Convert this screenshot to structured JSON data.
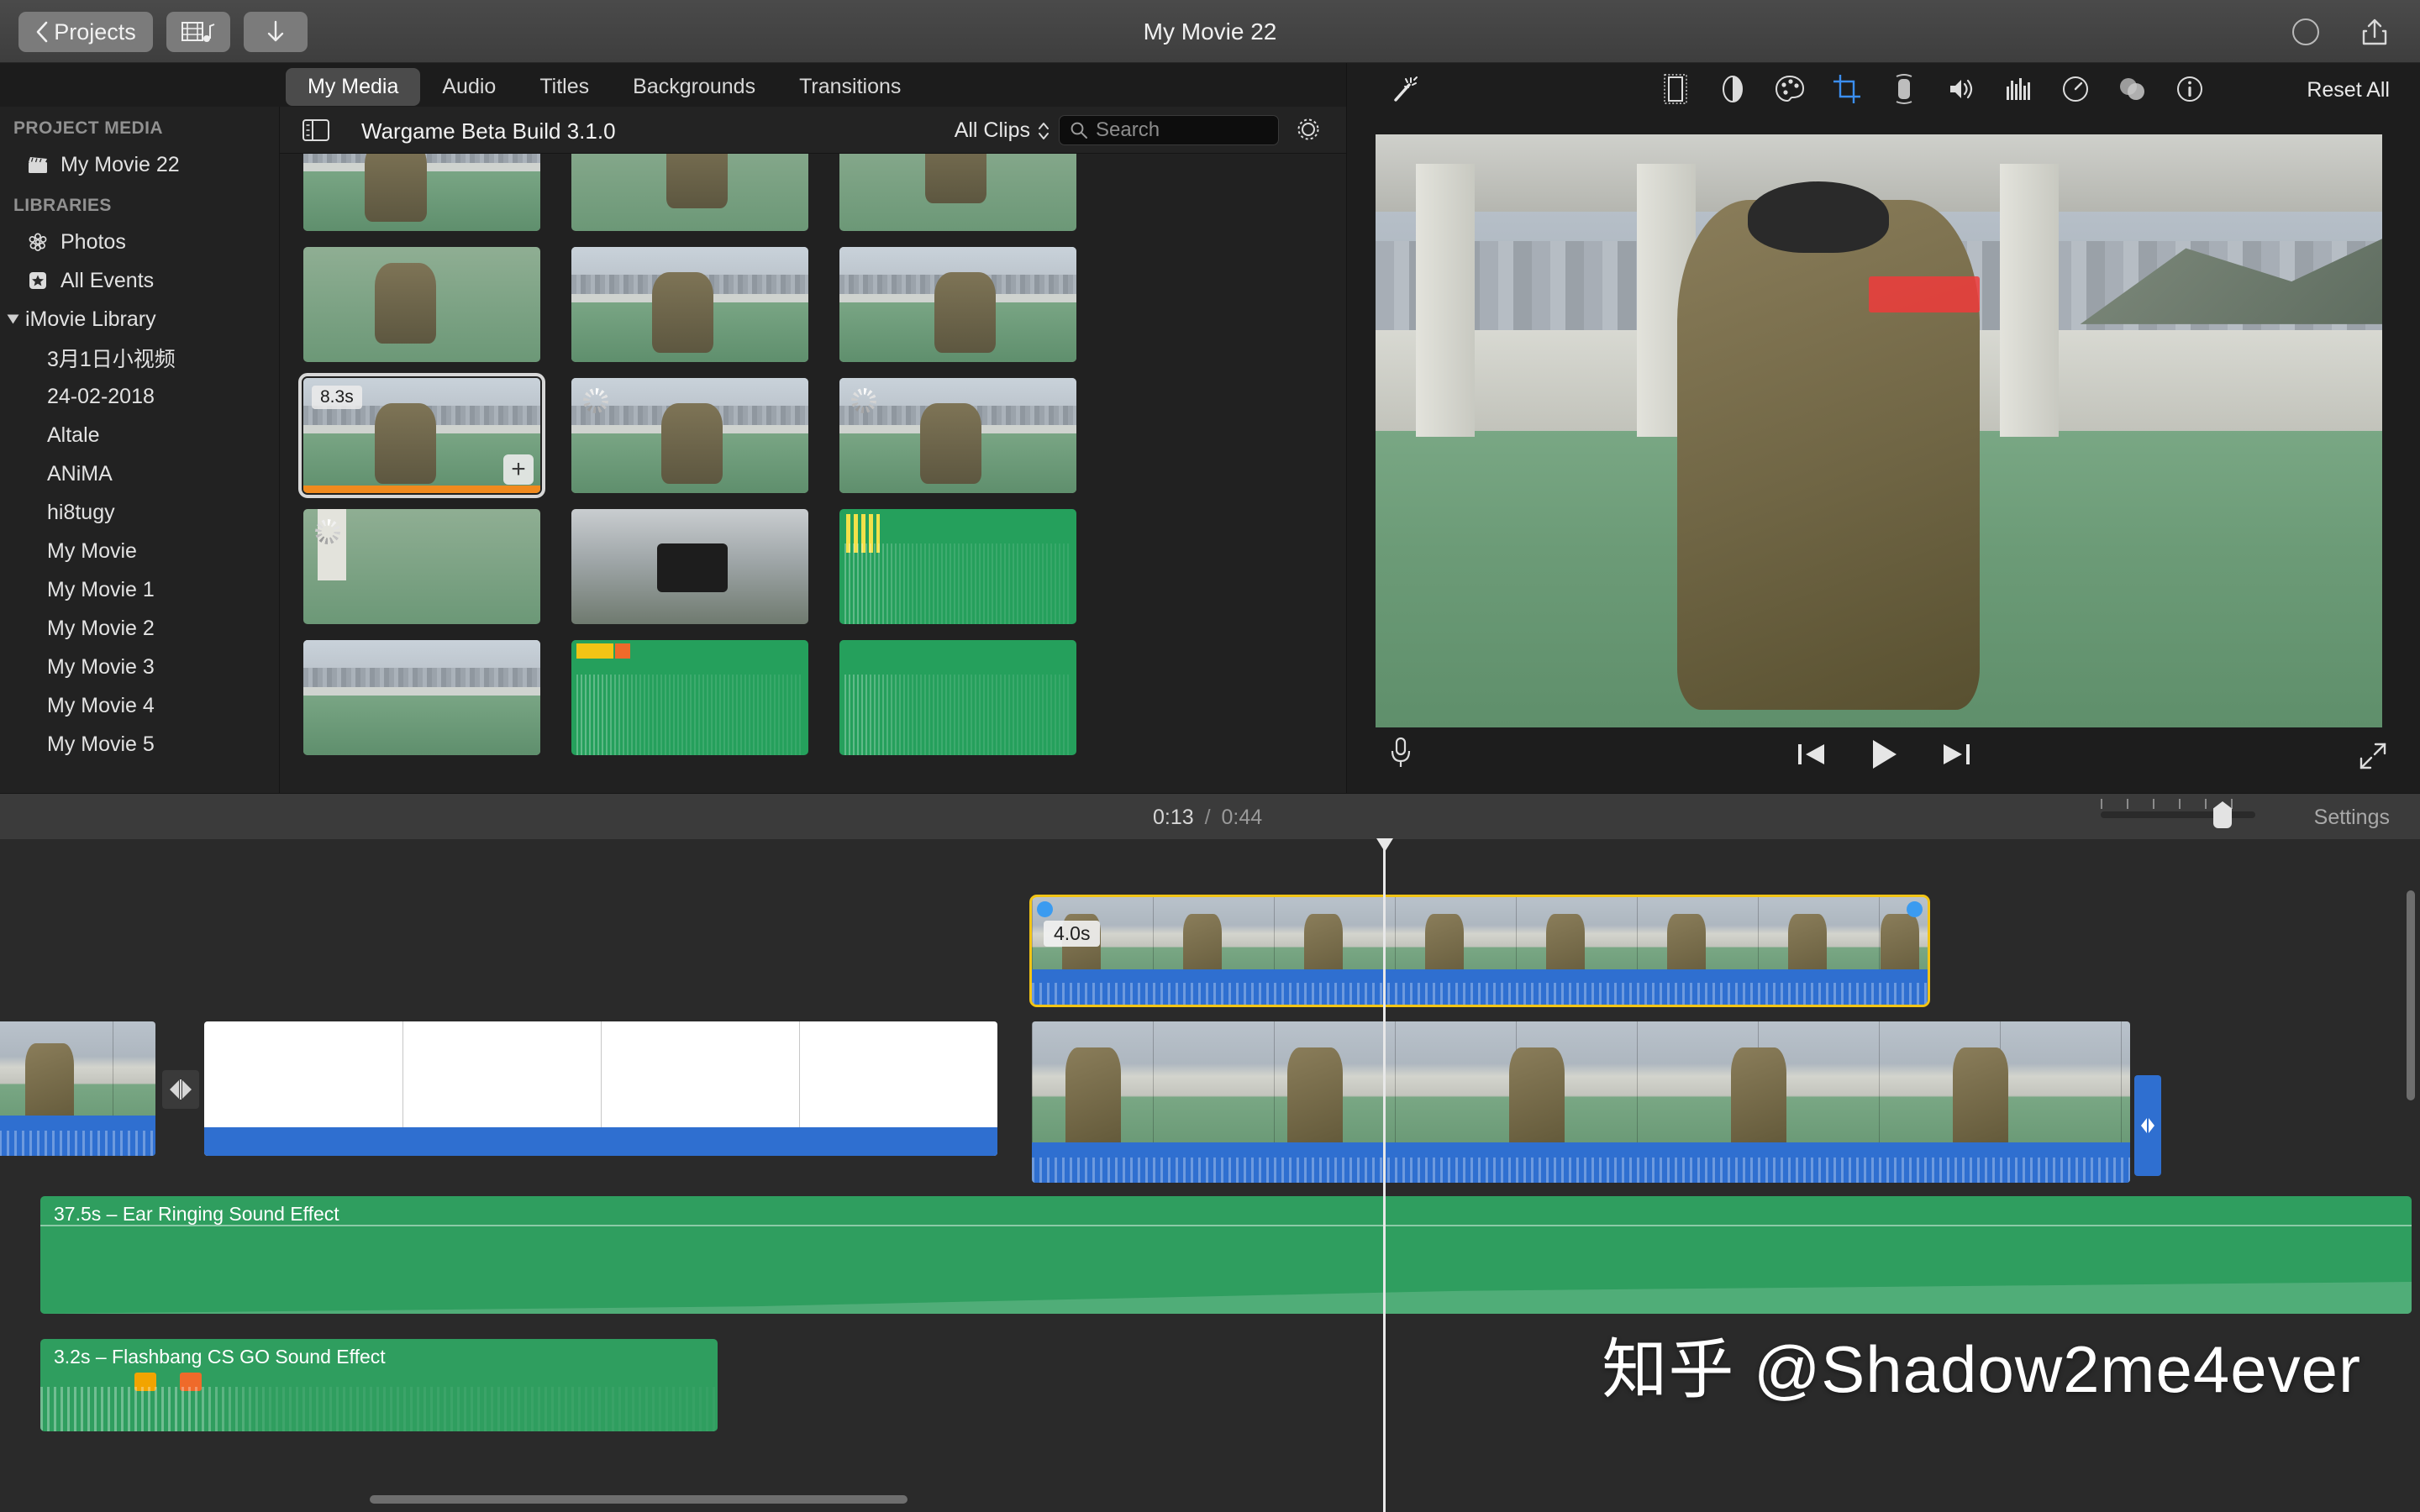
{
  "titlebar": {
    "back_label": "Projects",
    "import_icon": "film-music-icon",
    "download_icon": "download-arrow-icon",
    "project_title": "My Movie 22",
    "record_icon": "record-circle-icon",
    "share_icon": "share-icon"
  },
  "tabs": [
    {
      "label": "My Media",
      "active": true
    },
    {
      "label": "Audio",
      "active": false
    },
    {
      "label": "Titles",
      "active": false
    },
    {
      "label": "Backgrounds",
      "active": false
    },
    {
      "label": "Transitions",
      "active": false
    }
  ],
  "sidebar": {
    "project_media_header": "PROJECT MEDIA",
    "project_media_items": [
      {
        "label": "My Movie 22",
        "icon": "clapperboard-icon"
      }
    ],
    "libraries_header": "LIBRARIES",
    "library_items": [
      {
        "label": "Photos",
        "icon": "photos-flower-icon"
      },
      {
        "label": "All Events",
        "icon": "star-icon"
      }
    ],
    "imovie_library_label": "iMovie Library",
    "events": [
      "3月1日小视频",
      "24-02-2018",
      "Altale",
      "ANiMA",
      "hi8tugy",
      "My Movie",
      "My Movie 1",
      "My Movie 2",
      "My Movie 3",
      "My Movie 4",
      "My Movie 5"
    ]
  },
  "browser_toolbar": {
    "sidebar_toggle_icon": "sidebar-toggle-icon",
    "event_title": "Wargame Beta Build 3.1.0",
    "filter_label": "All Clips",
    "filter_icon": "chevron-updown-icon",
    "search_placeholder": "Search",
    "search_value": "",
    "search_icon": "search-icon",
    "settings_icon": "gear-icon"
  },
  "browser_clips": [
    {
      "row": 0,
      "col": 0,
      "kind": "video",
      "badge": "",
      "selected": false,
      "loading": false,
      "style": "rooftop-dark"
    },
    {
      "row": 0,
      "col": 1,
      "kind": "video",
      "badge": "",
      "selected": false,
      "loading": false,
      "style": "rooftop-green"
    },
    {
      "row": 0,
      "col": 2,
      "kind": "video",
      "badge": "",
      "selected": false,
      "loading": false,
      "style": "rooftop-green"
    },
    {
      "row": 1,
      "col": 0,
      "kind": "video",
      "badge": "",
      "selected": false,
      "loading": false,
      "style": "rooftop-green"
    },
    {
      "row": 1,
      "col": 1,
      "kind": "video",
      "badge": "",
      "selected": false,
      "loading": false,
      "style": "rooftop-city"
    },
    {
      "row": 1,
      "col": 2,
      "kind": "video",
      "badge": "",
      "selected": false,
      "loading": false,
      "style": "rooftop-city"
    },
    {
      "row": 2,
      "col": 0,
      "kind": "video",
      "badge": "8.3s",
      "selected": true,
      "loading": false,
      "style": "rooftop-city",
      "has_add": true,
      "range_selected": true
    },
    {
      "row": 2,
      "col": 1,
      "kind": "video",
      "badge": "",
      "selected": false,
      "loading": true,
      "style": "rooftop-city"
    },
    {
      "row": 2,
      "col": 2,
      "kind": "video",
      "badge": "",
      "selected": false,
      "loading": true,
      "style": "rooftop-city"
    },
    {
      "row": 3,
      "col": 0,
      "kind": "video",
      "badge": "",
      "selected": false,
      "loading": true,
      "style": "rooftop-floor"
    },
    {
      "row": 3,
      "col": 1,
      "kind": "video",
      "badge": "",
      "selected": false,
      "loading": false,
      "style": "indoor-scope"
    },
    {
      "row": 3,
      "col": 2,
      "kind": "audio",
      "badge": "",
      "selected": false,
      "loading": false,
      "style": "audio-green"
    },
    {
      "row": 4,
      "col": 0,
      "kind": "video",
      "badge": "",
      "selected": false,
      "loading": false,
      "style": "rooftop-city"
    },
    {
      "row": 4,
      "col": 1,
      "kind": "audio",
      "badge": "",
      "selected": false,
      "loading": false,
      "style": "audio-green"
    },
    {
      "row": 4,
      "col": 2,
      "kind": "audio",
      "badge": "",
      "selected": false,
      "loading": false,
      "style": "audio-green"
    }
  ],
  "viewer": {
    "magic_icon": "magic-wand-icon",
    "reset_label": "Reset All",
    "adjust_icons": [
      {
        "name": "crop-frame-icon",
        "selected": false
      },
      {
        "name": "color-balance-icon",
        "selected": false
      },
      {
        "name": "color-correction-icon",
        "selected": false
      },
      {
        "name": "crop-icon",
        "selected": true
      },
      {
        "name": "stabilization-icon",
        "selected": false
      },
      {
        "name": "volume-icon",
        "selected": false
      },
      {
        "name": "equalizer-icon",
        "selected": false
      },
      {
        "name": "speed-icon",
        "selected": false
      },
      {
        "name": "filter-icon",
        "selected": false
      },
      {
        "name": "info-icon",
        "selected": false
      }
    ],
    "controls": {
      "mic_icon": "microphone-icon",
      "prev_icon": "skip-previous-icon",
      "play_icon": "play-icon",
      "next_icon": "skip-next-icon",
      "fullscreen_icon": "expand-icon"
    }
  },
  "timeline_header": {
    "current_time": "0:13",
    "separator": "/",
    "total_time": "0:44",
    "settings_label": "Settings",
    "zoom_value": 73
  },
  "timeline": {
    "selected_clip_badge": "4.0s",
    "clips": [
      {
        "name": "video-clip-left-partial",
        "label": ""
      },
      {
        "name": "transition-clip",
        "label": ""
      },
      {
        "name": "white-title-clip",
        "label": ""
      },
      {
        "name": "video-clip-right",
        "label": ""
      },
      {
        "name": "video-clip-selected",
        "label": "4.0s"
      }
    ],
    "audio_tracks": [
      {
        "label": "37.5s – Ear Ringing Sound Effect",
        "color": "#2f9e5f"
      },
      {
        "label": "3.2s – Flashbang CS GO Sound Effect",
        "color": "#2f9e5f"
      }
    ]
  },
  "watermark": {
    "text": "知乎 @Shadow2me4ever"
  },
  "colors": {
    "accent_yellow": "#f2c415",
    "audio_blue": "#2f6fd0",
    "audio_green": "#2f9e5f",
    "orange_range": "#f08a1e",
    "selected_blue": "#3b9bf0"
  }
}
